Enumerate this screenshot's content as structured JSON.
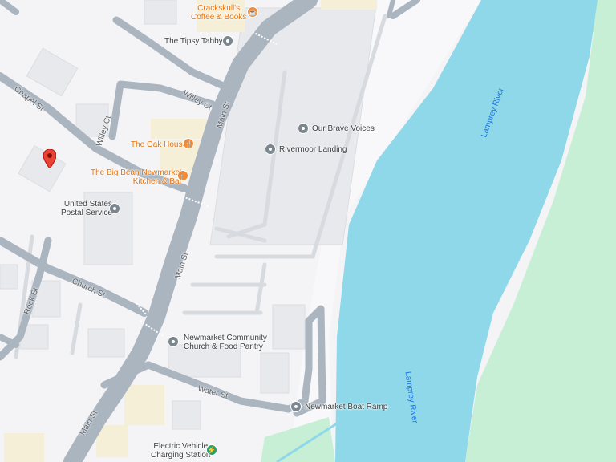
{
  "map": {
    "colors": {
      "land": "#f4f4f6",
      "road": "#aab5c0",
      "building": "#e8e9ec",
      "water": "#8ed8ea",
      "park": "#c6efd5",
      "shore_land": "#ffffff",
      "poi_orange": "#e8710a",
      "pin_red": "#ea4335"
    },
    "places": {
      "crackskulls": "Crackskull's\nCoffee & Books",
      "tipsy_tabby": "The Tipsy Tabby",
      "oak_house": "The Oak House",
      "big_bean": "The Big Bean Newmarket\nKitchen & Bar",
      "our_brave_voices": "Our Brave Voices",
      "rivermoor_landing": "Rivermoor Landing",
      "usps": "United States\nPostal Service",
      "community_church": "Newmarket Community\nChurch & Food Pantry",
      "boat_ramp": "Newmarket Boat Ramp",
      "ev_station": "Electric Vehicle\nCharging Station"
    },
    "streets": {
      "chapel": "Chapel St",
      "willey_1": "Willey Ct",
      "willey_2": "Willey Ct",
      "main_1": "Main St",
      "main_2": "Main St",
      "main_3": "Main St",
      "church": "Church St",
      "rock": "Rock St",
      "water": "Water St"
    },
    "water": {
      "river_1": "Lamprey River",
      "river_2": "Lamprey River"
    },
    "icons": {
      "cafe": "cafe-icon",
      "restaurant": "restaurant-icon",
      "post": "mail-icon",
      "church": "church-cross-icon",
      "ev": "ev-charging-icon",
      "generic": "place-pin-icon",
      "dropped_pin": "dropped-pin-icon"
    }
  }
}
